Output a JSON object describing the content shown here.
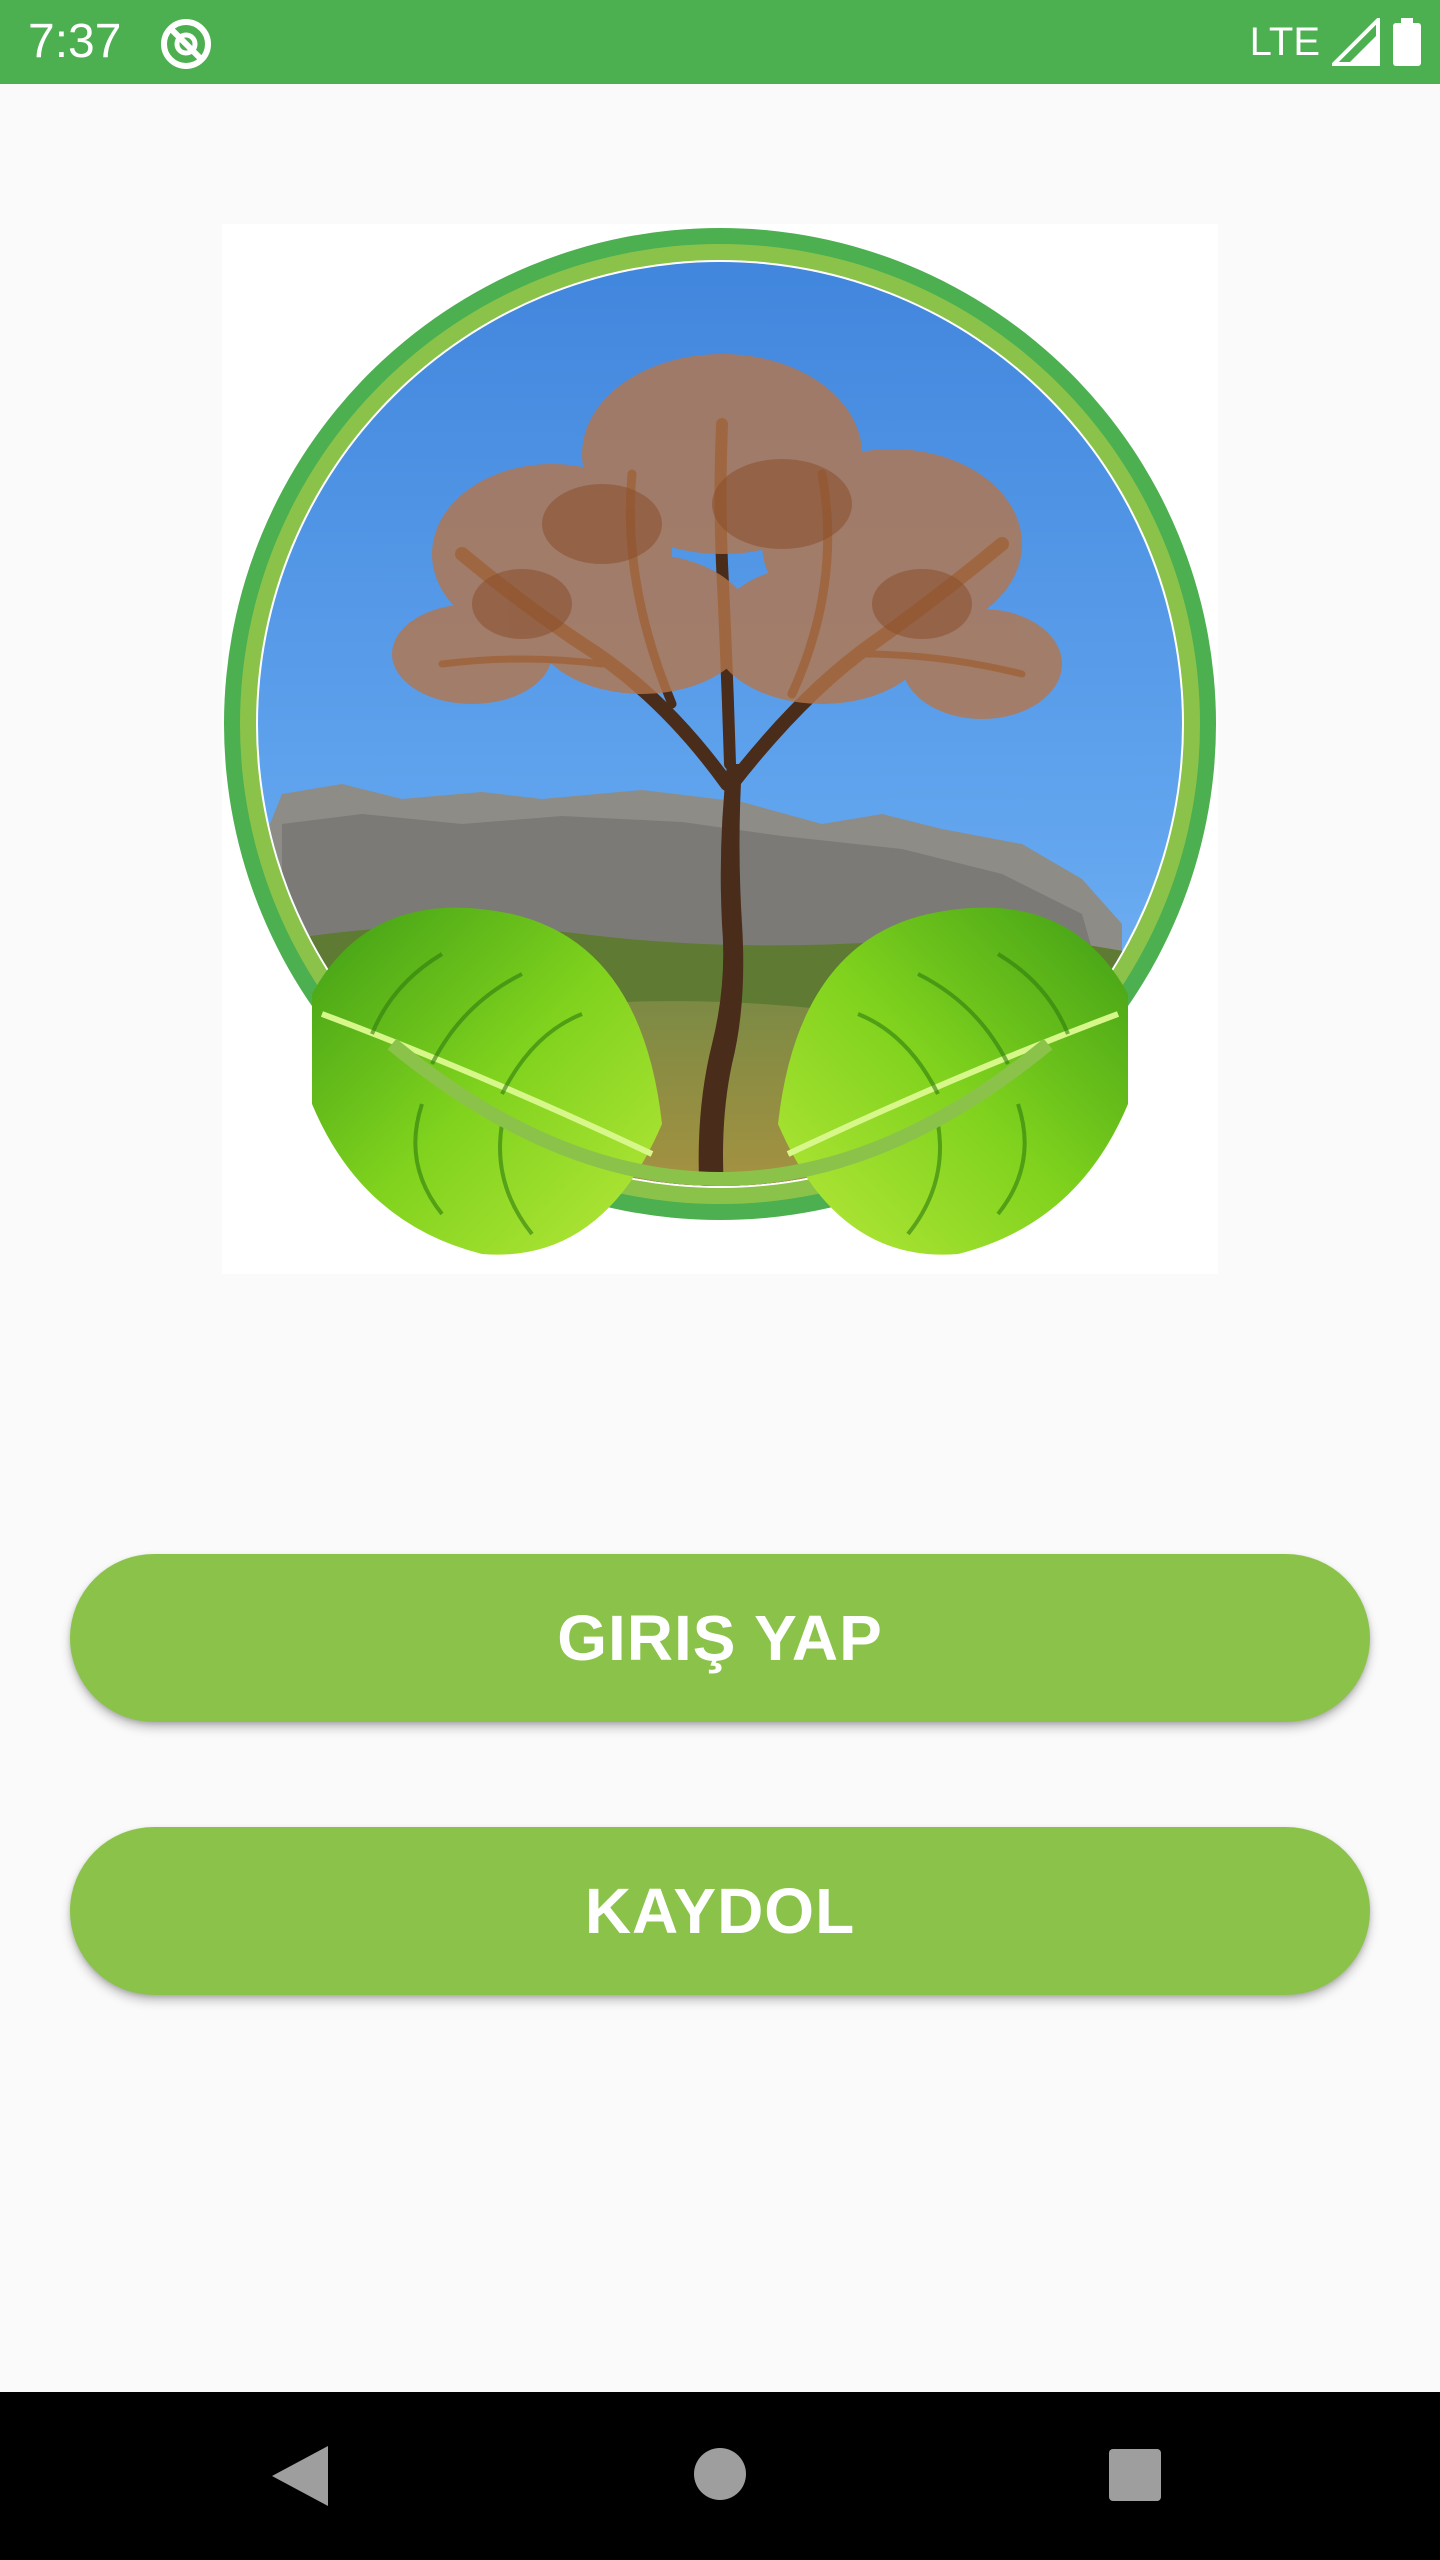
{
  "status_bar": {
    "time": "7:37",
    "network_label": "LTE",
    "icons": [
      "app-notification-icon",
      "signal-icon",
      "battery-icon"
    ],
    "color": "#4caf50"
  },
  "hero": {
    "image_description_icon": "tree-logo-icon"
  },
  "buttons": {
    "login_label": "GIRIŞ YAP",
    "register_label": "KAYDOL",
    "color": "#8bc34a"
  },
  "nav_bar": {
    "icons": [
      "back-icon",
      "home-icon",
      "recents-icon"
    ]
  }
}
